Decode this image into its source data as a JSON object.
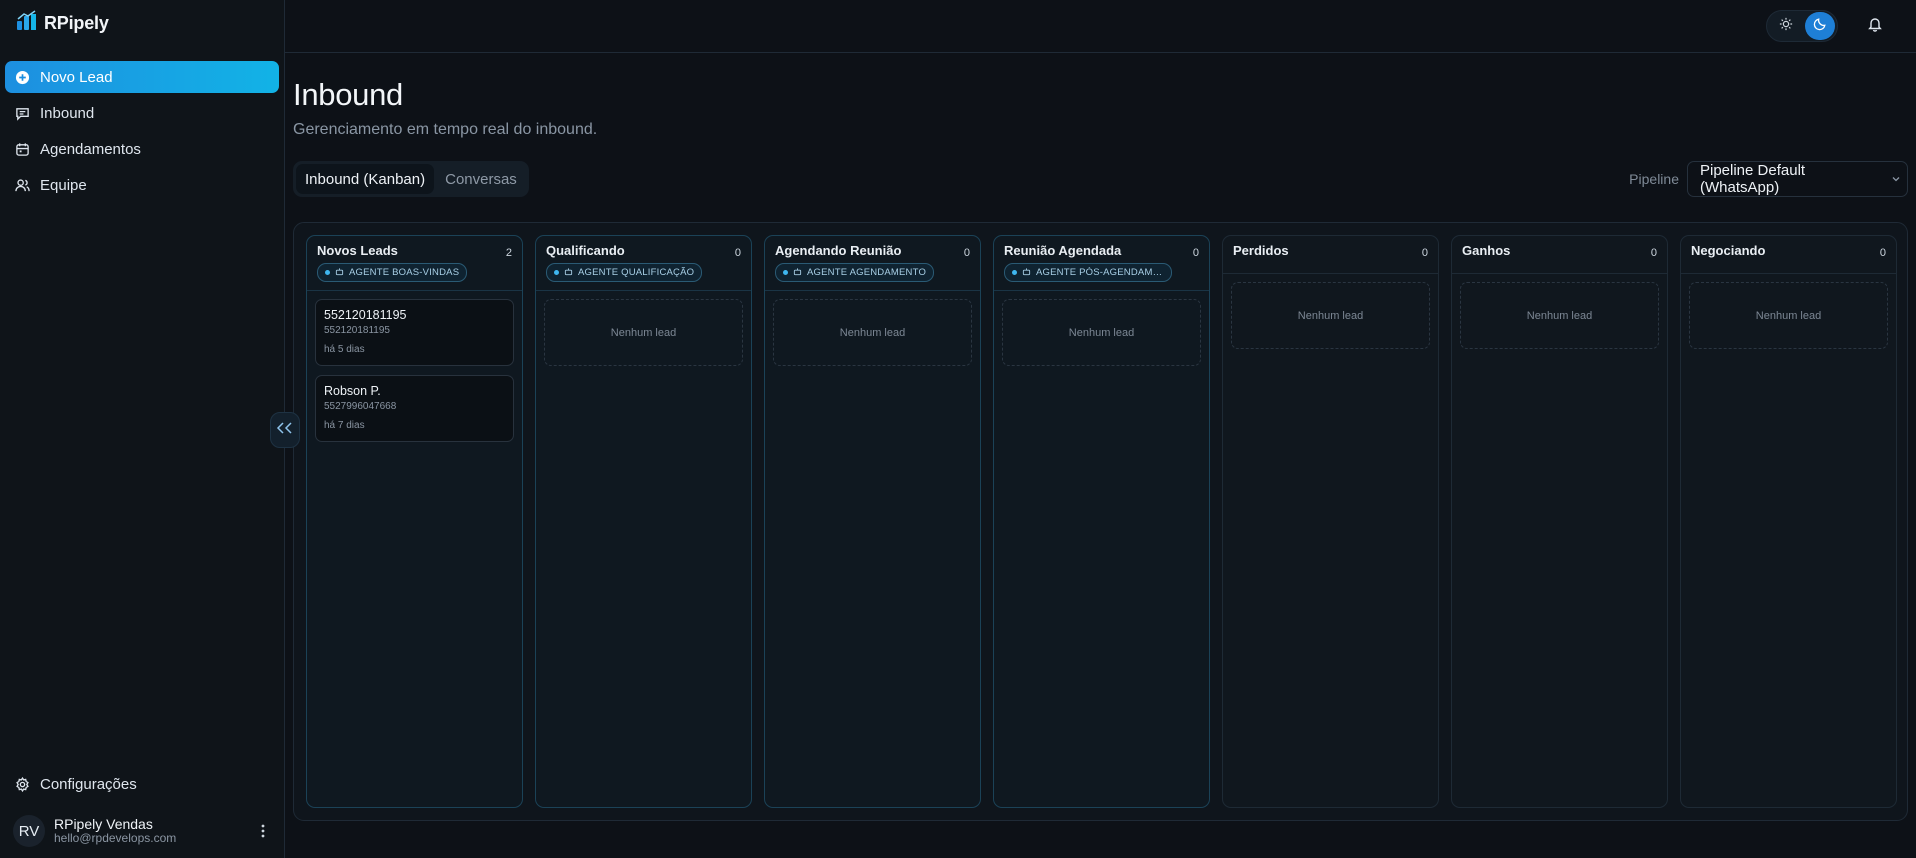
{
  "brand": {
    "name": "RPipely"
  },
  "sidebar": {
    "items": [
      {
        "label": "Novo Lead",
        "icon": "plus-circle-icon"
      },
      {
        "label": "Inbound",
        "icon": "chat-icon"
      },
      {
        "label": "Agendamentos",
        "icon": "calendar-icon"
      },
      {
        "label": "Equipe",
        "icon": "users-icon"
      }
    ],
    "settings_label": "Configurações",
    "user": {
      "initials": "RV",
      "name": "RPipely Vendas",
      "email": "hello@rpdevelops.com"
    }
  },
  "page": {
    "title": "Inbound",
    "subtitle": "Gerenciamento em tempo real do inbound."
  },
  "tabs": [
    {
      "label": "Inbound (Kanban)",
      "active": true
    },
    {
      "label": "Conversas",
      "active": false
    }
  ],
  "pipeline": {
    "label": "Pipeline",
    "selected": "Pipeline Default (WhatsApp)"
  },
  "columns": [
    {
      "title": "Novos Leads",
      "count": "2",
      "agent": "AGENTE BOAS-VINDAS"
    },
    {
      "title": "Qualificando",
      "count": "0",
      "agent": "AGENTE QUALIFICAÇÃO"
    },
    {
      "title": "Agendando Reunião",
      "count": "0",
      "agent": "AGENTE AGENDAMENTO"
    },
    {
      "title": "Reunião Agendada",
      "count": "0",
      "agent": "AGENTE PÓS-AGENDAMENTO"
    },
    {
      "title": "Perdidos",
      "count": "0"
    },
    {
      "title": "Ganhos",
      "count": "0"
    },
    {
      "title": "Negociando",
      "count": "0"
    }
  ],
  "leads": [
    {
      "name": "552120181195",
      "phone": "552120181195",
      "age": "há 5 dias"
    },
    {
      "name": "Robson P.",
      "phone": "5527996047668",
      "age": "há 7 dias"
    }
  ],
  "empty_label": "Nenhum lead",
  "colors": {
    "accent": "#1d8fe0",
    "accent_end": "#12b3e6",
    "background": "#0d1117"
  }
}
